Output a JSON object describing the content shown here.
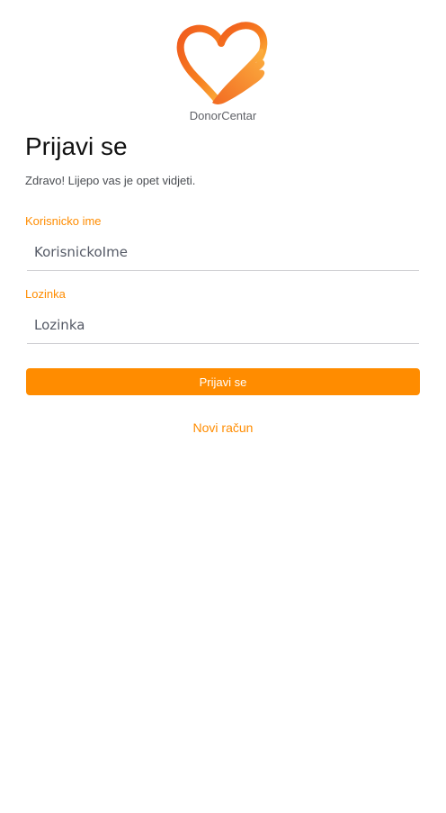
{
  "app": {
    "brand_name": "DonorCentar",
    "logo_icon": "heart-hand-icon",
    "accent_color": "#ff8c00"
  },
  "login": {
    "title": "Prijavi se",
    "subtitle": "Zdravo! Lijepo vas je opet vidjeti.",
    "username_label": "Korisnicko ime",
    "username_placeholder": "KorisnickoIme",
    "username_value": "",
    "password_label": "Lozinka",
    "password_placeholder": "Lozinka",
    "password_value": "",
    "submit_label": "Prijavi se",
    "register_link": "Novi račun"
  }
}
